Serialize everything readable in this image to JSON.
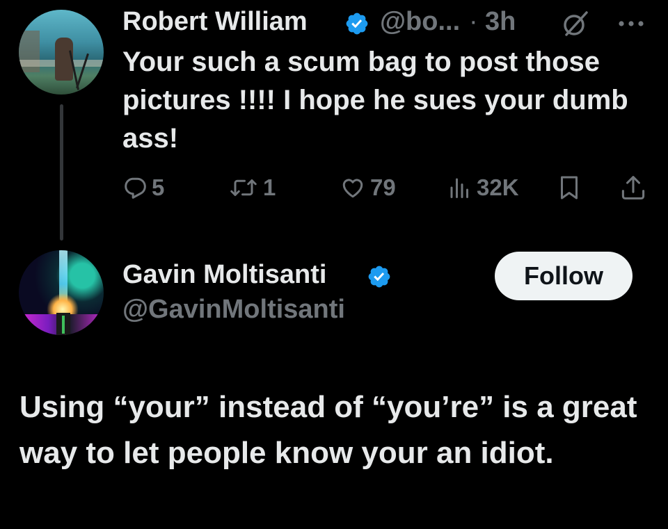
{
  "colors": {
    "background": "#000000",
    "text": "#e7e9ea",
    "muted": "#71767b",
    "verified": "#1d9bf0",
    "follow_bg": "#eff3f4",
    "follow_text": "#0f1419"
  },
  "parent_tweet": {
    "author_name": "Robert William",
    "handle": "@bo...",
    "separator": "·",
    "time": "3h",
    "text": "Your such a scum bag to post those pictures !!!! I hope he sues your dumb ass!",
    "icons": {
      "verified": "verified-badge-icon",
      "grok": "grok-icon",
      "more": "more-options-icon"
    },
    "actions": {
      "replies": "5",
      "retweets": "1",
      "likes": "79",
      "views": "32K"
    }
  },
  "main_tweet": {
    "author_name": "Gavin Moltisanti",
    "handle": "@GavinMoltisanti",
    "follow_label": "Follow",
    "text": "Using “your” instead of “you’re” is a great way to let people know your an idiot."
  }
}
